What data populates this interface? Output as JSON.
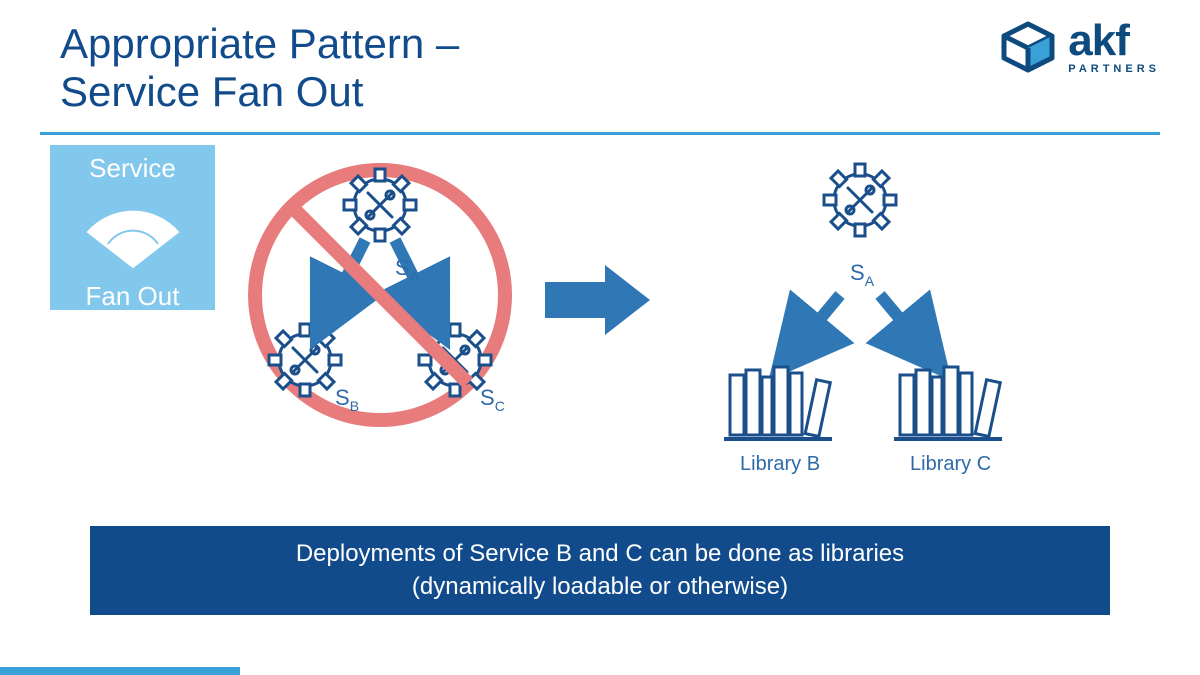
{
  "title_line1": "Appropriate Pattern –",
  "title_line2": "Service Fan Out",
  "logo": {
    "brand": "akf",
    "sub": "PARTNERS"
  },
  "badge": {
    "top": "Service",
    "bottom": "Fan Out"
  },
  "left": {
    "sa": "S",
    "sa_sub": "A",
    "sb": "S",
    "sb_sub": "B",
    "sc": "S",
    "sc_sub": "C"
  },
  "right": {
    "sa": "S",
    "sa_sub": "A",
    "lib_b": "Library B",
    "lib_c": "Library C"
  },
  "banner_line1": "Deployments of Service B and C can be done as libraries",
  "banner_line2": "(dynamically loadable or otherwise)",
  "colors": {
    "brand_dark": "#114b8c",
    "brand_mid": "#2f6aa8",
    "accent": "#3aa1d8",
    "badge_bg": "#82c7ec",
    "prohibited": "#e87c7c"
  }
}
